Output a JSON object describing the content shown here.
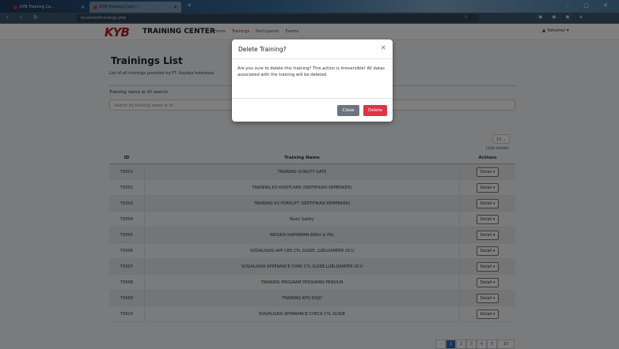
{
  "browser": {
    "tabs": [
      {
        "label": "KYB Training Ce..."
      },
      {
        "label": "KYB Training Cent..."
      }
    ],
    "new_tab": "+",
    "nav_buttons": "‹ › ↻",
    "url": "localhost/trainings.php",
    "window_controls": "– ▢ ✕"
  },
  "navbar": {
    "logo": "KYB",
    "brand": "TRAINING CENTER",
    "links": [
      "Home",
      "Trainings",
      "Participants",
      "Events"
    ],
    "user": "Yohomei"
  },
  "page": {
    "title": "Trainings List",
    "subtitle": "List of all trainings provided by PT. Kayaba Indonesia",
    "search_label": "Training name or ID search",
    "search_placeholder": "Search by training name or id",
    "show_value": "10",
    "show_label": "Lists shown"
  },
  "table": {
    "headers": [
      "ID",
      "Training Name",
      "Actions"
    ],
    "rows": [
      {
        "id": "T0001",
        "name": "TRAINING QUALITY GATE",
        "action": "Detail"
      },
      {
        "id": "T0002",
        "name": "TRAINING K3 HOISTCARE (SERTIFIKASI KEMENKER)",
        "action": "Detail"
      },
      {
        "id": "T0003",
        "name": "TRAINING K3 FORKLIFT (SERTIFIKASI KEMENKER)",
        "action": "Detail"
      },
      {
        "id": "T0004",
        "name": "Basic Safety",
        "action": "Detail"
      },
      {
        "id": "T0005",
        "name": "INDUKSI KARYAWAN BARU & PKL",
        "action": "Detail"
      },
      {
        "id": "T0006",
        "name": "SOSIALISASI APP CEK CYL GUIDE, LUBLDAMPER OCU",
        "action": "Detail"
      },
      {
        "id": "T0007",
        "name": "SOSIALISASI APPERANCE CHEK CYL GUIDE,LUBLDAMPER OCU",
        "action": "Detail"
      },
      {
        "id": "T0008",
        "name": "TRAINING PROGRAM PERSIAPAN PENSIUN",
        "action": "Detail"
      },
      {
        "id": "T0009",
        "name": "TRAINING KPQ DOJO",
        "action": "Detail"
      },
      {
        "id": "T0010",
        "name": "SOSIALISASI APPARANCE CHECK CYL GUIDE",
        "action": "Detail"
      }
    ]
  },
  "pagination": {
    "pages": [
      "1",
      "2",
      "3",
      "4",
      "5"
    ],
    "select": "10"
  },
  "modal": {
    "title": "Delete Training?",
    "close_icon": "×",
    "body": "Are you sure to delete this training? This action is irreversible! All datas associated with the training will be deleted.",
    "close_label": "Close",
    "delete_label": "Delete"
  },
  "colors": {
    "brand_red": "#c4161c",
    "delete_red": "#dc3545",
    "close_gray": "#6c757d",
    "page_blue": "#2a6ab7"
  }
}
